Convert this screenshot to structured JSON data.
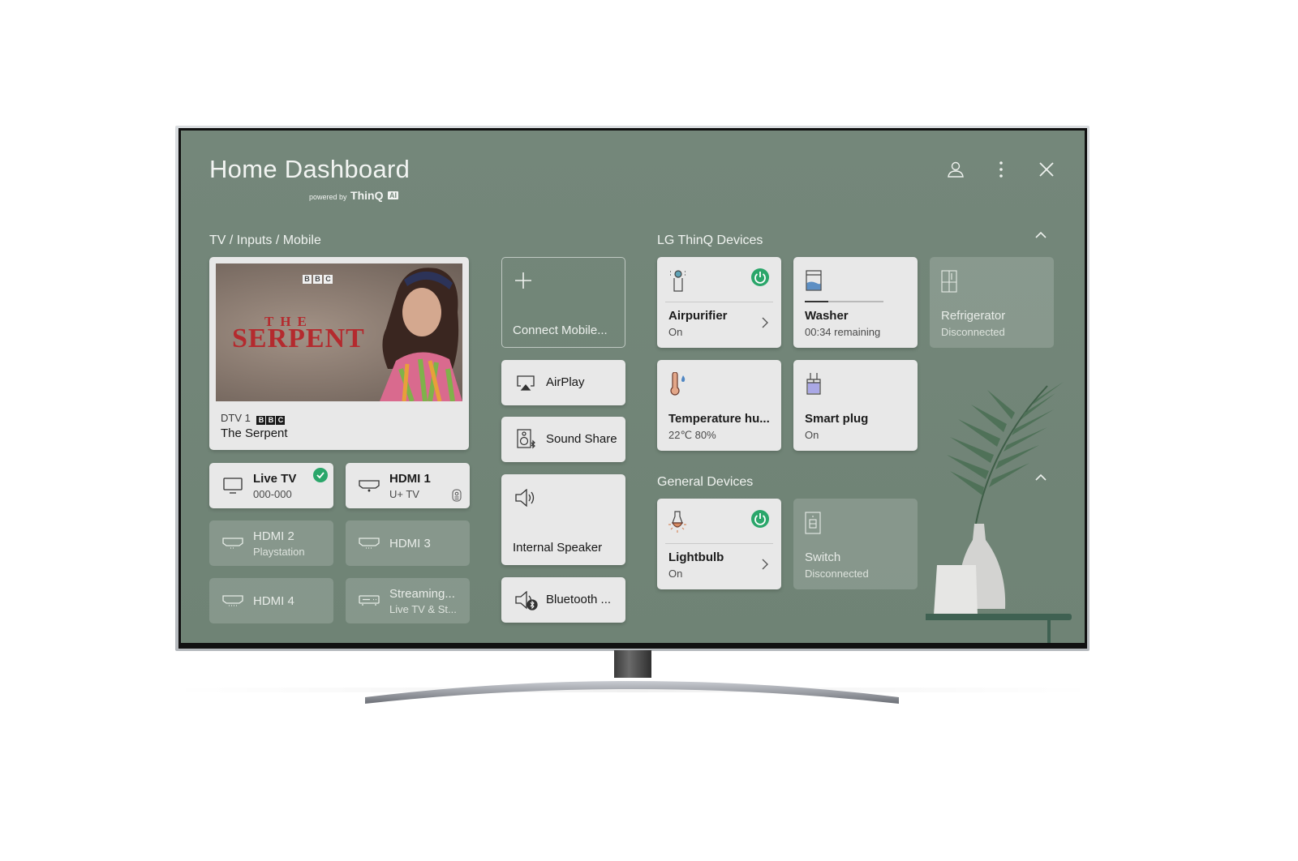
{
  "header": {
    "title": "Home Dashboard",
    "powered_by": "powered by",
    "brand": "ThinQ",
    "brand_badge": "AI",
    "icons": [
      "profile-icon",
      "more-options-icon",
      "close-icon"
    ]
  },
  "tv_inputs": {
    "section_title": "TV / Inputs / Mobile",
    "now_playing": {
      "poster_logo": "BBC",
      "poster_title_small": "THE",
      "poster_title_large": "SERPENT",
      "channel": "DTV 1",
      "channel_logo": [
        "B",
        "B",
        "C"
      ],
      "program": "The Serpent"
    },
    "inputs": [
      {
        "name": "Live TV",
        "sub": "000-000",
        "icon": "tv-icon",
        "active": true,
        "selected": true
      },
      {
        "name": "HDMI 1",
        "sub": "U+ TV",
        "icon": "hdmi-icon",
        "active": true,
        "badge_icon": "remote-icon"
      },
      {
        "name": "HDMI 2",
        "sub": "Playstation",
        "icon": "hdmi-icon",
        "active": false
      },
      {
        "name": "HDMI 3",
        "sub": "",
        "icon": "hdmi-icon",
        "active": false
      },
      {
        "name": "HDMI 4",
        "sub": "",
        "icon": "hdmi-icon",
        "active": false
      },
      {
        "name": "Streaming...",
        "sub": "Live TV & St...",
        "icon": "set-top-box-icon",
        "active": false
      }
    ]
  },
  "mobile_audio": {
    "connect_mobile": "Connect Mobile...",
    "airplay": "AirPlay",
    "sound_share": "Sound Share",
    "internal_speaker": "Internal Speaker",
    "bluetooth": "Bluetooth ..."
  },
  "thinq_devices": {
    "section_title": "LG ThinQ Devices",
    "devices": [
      {
        "name": "Airpurifier",
        "status": "On",
        "icon": "air-purifier-icon",
        "power_on": true
      },
      {
        "name": "Washer",
        "status": "00:34 remaining",
        "icon": "washer-icon",
        "progress": 0.3
      },
      {
        "name": "Refrigerator",
        "status": "Disconnected",
        "icon": "refrigerator-icon",
        "disconnected": true
      },
      {
        "name": "Temperature hu...",
        "status": "22℃ 80%",
        "icon": "thermo-hygrometer-icon"
      },
      {
        "name": "Smart plug",
        "status": "On",
        "icon": "smart-plug-icon"
      }
    ]
  },
  "general_devices": {
    "section_title": "General Devices",
    "devices": [
      {
        "name": "Lightbulb",
        "status": "On",
        "icon": "lightbulb-icon",
        "power_on": true
      },
      {
        "name": "Switch",
        "status": "Disconnected",
        "icon": "switch-icon",
        "disconnected": true
      }
    ]
  },
  "colors": {
    "screen_bg": "#74877a",
    "card_bg": "#e8e8e8",
    "power_green": "#2aa66a",
    "poster_title_red": "#b42a2e"
  }
}
